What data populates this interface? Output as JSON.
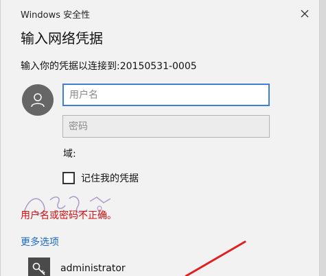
{
  "window": {
    "title": "Windows 安全性"
  },
  "dialog": {
    "heading": "输入网络凭据",
    "connect_text": "输入你的凭据以连接到:20150531-0005",
    "username_placeholder": "用户名",
    "password_placeholder": "密码",
    "domain_label": "域:",
    "remember_label": "记住我的凭据",
    "error_text": "用户名或密码不正确。",
    "more_options": "更多选项",
    "account_name": "administrator"
  },
  "colors": {
    "accent": "#3d7fd6",
    "error": "#d30f0f",
    "link": "#1a6bc4",
    "avatar": "#666666"
  },
  "icons": {
    "close": "close-icon",
    "avatar": "user-avatar-icon",
    "key": "key-icon"
  }
}
